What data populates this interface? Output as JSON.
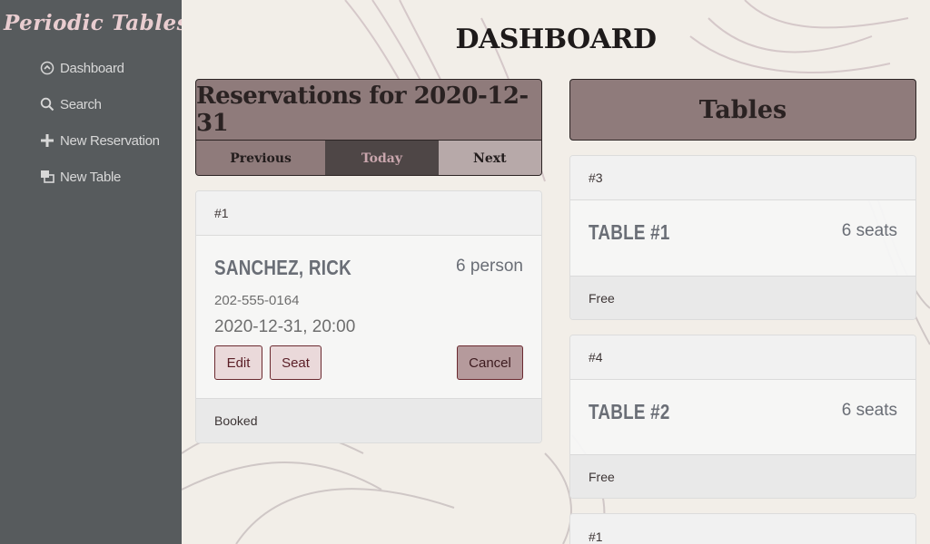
{
  "sidebar": {
    "brand": "Periodic Tables",
    "items": [
      {
        "label": "Dashboard",
        "icon": "dashboard-icon"
      },
      {
        "label": "Search",
        "icon": "search-icon"
      },
      {
        "label": "New Reservation",
        "icon": "plus-icon"
      },
      {
        "label": "New Table",
        "icon": "layers-icon"
      }
    ]
  },
  "page": {
    "title": "DASHBOARD"
  },
  "reservations": {
    "title": "Reservations for 2020-12-31",
    "nav": {
      "previous": "Previous",
      "today": "Today",
      "next": "Next"
    },
    "items": [
      {
        "id": "#1",
        "name": "SANCHEZ, RICK",
        "people": "6 person",
        "phone": "202-555-0164",
        "datetime": "2020-12-31, 20:00",
        "edit": "Edit",
        "seat": "Seat",
        "cancel": "Cancel",
        "status": "Booked"
      }
    ]
  },
  "tables": {
    "title": "Tables",
    "items": [
      {
        "id": "#3",
        "name": "TABLE #1",
        "seats": "6 seats",
        "status": "Free"
      },
      {
        "id": "#4",
        "name": "TABLE #2",
        "seats": "6 seats",
        "status": "Free"
      },
      {
        "id": "#1"
      }
    ]
  },
  "colors": {
    "sidebar_bg": "#575b5d",
    "brand": "#e9cdd0",
    "header_panel": "#8f7b7b",
    "today_active": "#4e4646",
    "button_border": "#6b2a30"
  }
}
